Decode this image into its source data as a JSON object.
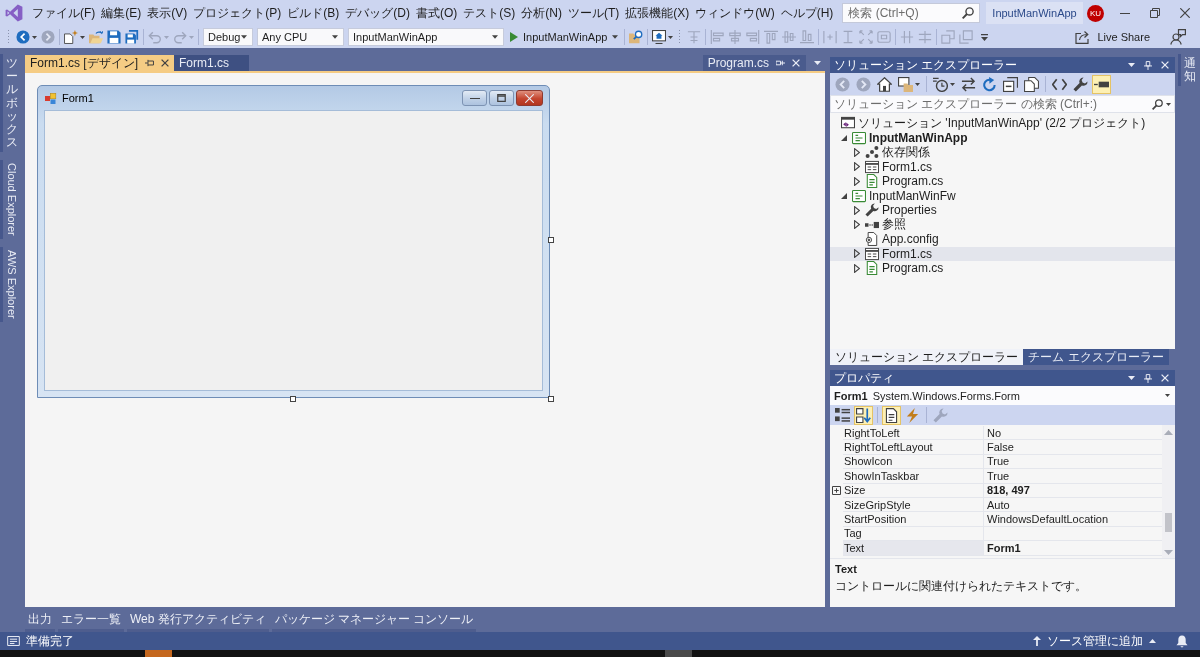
{
  "title_bar": {
    "menu": [
      "ファイル(F)",
      "編集(E)",
      "表示(V)",
      "プロジェクト(P)",
      "ビルド(B)",
      "デバッグ(D)",
      "書式(O)",
      "テスト(S)",
      "分析(N)",
      "ツール(T)",
      "拡張機能(X)",
      "ウィンドウ(W)",
      "ヘルプ(H)"
    ],
    "search": {
      "placeholder": "検索 (Ctrl+Q)"
    },
    "solution_name": "InputManWinApp",
    "user_initials": "KU"
  },
  "toolbar": {
    "items": [
      {
        "kind": "grip"
      },
      {
        "kind": "back",
        "disabled": false,
        "menu": true
      },
      {
        "kind": "forward",
        "disabled": true,
        "menu": false
      },
      {
        "kind": "separator"
      },
      {
        "kind": "new-item",
        "disabled": false,
        "menu": true
      },
      {
        "kind": "open",
        "disabled": false,
        "menu": false
      },
      {
        "kind": "save",
        "disabled": false,
        "menu": false
      },
      {
        "kind": "save-all",
        "disabled": false,
        "menu": false
      },
      {
        "kind": "separator"
      },
      {
        "kind": "undo",
        "disabled": true,
        "menu": true
      },
      {
        "kind": "redo",
        "disabled": true,
        "menu": true
      },
      {
        "kind": "separator"
      },
      {
        "kind": "dropdown",
        "value": "Debug"
      },
      {
        "kind": "dropdown",
        "value": "Any CPU"
      },
      {
        "kind": "dropdown",
        "value": "InputManWinApp"
      },
      {
        "kind": "start",
        "label": "InputManWinApp"
      },
      {
        "kind": "separator"
      },
      {
        "kind": "find-folder",
        "disabled": false,
        "menu": false
      },
      {
        "kind": "separator"
      },
      {
        "kind": "screen",
        "disabled": false,
        "menu": true
      },
      {
        "kind": "grip"
      },
      {
        "kind": "align-grid",
        "disabled": true,
        "menu": false
      },
      {
        "kind": "separator"
      },
      {
        "kind": "align-left",
        "disabled": true,
        "menu": false
      },
      {
        "kind": "align-center",
        "disabled": true,
        "menu": false
      },
      {
        "kind": "align-right",
        "disabled": true,
        "menu": false
      },
      {
        "kind": "align-top",
        "disabled": true,
        "menu": false
      },
      {
        "kind": "align-middle",
        "disabled": true,
        "menu": false
      },
      {
        "kind": "align-bottom",
        "disabled": true,
        "menu": false
      },
      {
        "kind": "separator"
      },
      {
        "kind": "space-h",
        "disabled": true,
        "menu": false
      },
      {
        "kind": "same-height",
        "disabled": true,
        "menu": false
      },
      {
        "kind": "same-size",
        "disabled": true,
        "menu": false
      },
      {
        "kind": "size-grid",
        "disabled": true,
        "menu": false
      },
      {
        "kind": "separator"
      },
      {
        "kind": "center-h",
        "disabled": true,
        "menu": false
      },
      {
        "kind": "center-v",
        "disabled": true,
        "menu": false
      },
      {
        "kind": "separator"
      },
      {
        "kind": "bring-front",
        "disabled": true,
        "menu": false
      },
      {
        "kind": "send-back",
        "disabled": true,
        "menu": false
      },
      {
        "kind": "overflow"
      }
    ],
    "live_share": "Live Share"
  },
  "left_tabs": [
    {
      "label": "ツールボックス",
      "kind": "cjk"
    },
    {
      "label": "Cloud Explorer",
      "kind": "latin"
    },
    {
      "label": "AWS Explorer",
      "kind": "latin"
    }
  ],
  "document_tabs": [
    {
      "label": "Form1.cs [デザイン]",
      "selected": true,
      "buttons": true,
      "preview": false
    },
    {
      "label": "Form1.cs",
      "selected": false,
      "buttons": false,
      "preview": false
    },
    {
      "label": "Program.cs",
      "selected": false,
      "buttons": true,
      "preview": true
    }
  ],
  "designer": {
    "form_title": "Form1"
  },
  "bottom_tabs": [
    "出力",
    "エラー一覧",
    "Web 発行アクティビティ",
    "パッケージ マネージャー コンソール"
  ],
  "solution_explorer": {
    "title": "ソリューション エクスプローラー",
    "toolbar": [
      {
        "kind": "back",
        "disabled": true,
        "selected": false
      },
      {
        "kind": "forward",
        "disabled": true,
        "selected": false
      },
      {
        "kind": "home",
        "disabled": false,
        "selected": false
      },
      {
        "kind": "switch-views",
        "disabled": false,
        "selected": false,
        "menu": true
      },
      {
        "kind": "separator"
      },
      {
        "kind": "history",
        "disabled": false,
        "selected": false,
        "menu": true
      },
      {
        "kind": "sync",
        "disabled": false,
        "selected": false
      },
      {
        "kind": "refresh",
        "disabled": false,
        "selected": false
      },
      {
        "kind": "collapse-all",
        "disabled": false,
        "selected": false
      },
      {
        "kind": "show-all",
        "disabled": false,
        "selected": false
      },
      {
        "kind": "separator"
      },
      {
        "kind": "view-code",
        "disabled": false,
        "selected": false
      },
      {
        "kind": "wrench",
        "disabled": false,
        "selected": false
      },
      {
        "kind": "preview",
        "disabled": false,
        "selected": true
      }
    ],
    "search": {
      "placeholder": "ソリューション エクスプローラー の検索 (Ctrl+:)"
    },
    "tree": [
      {
        "label": "ソリューション 'InputManWinApp' (2/2 プロジェクト)",
        "kind": "solution",
        "selected": false,
        "children": [
          {
            "label": "InputManWinApp",
            "kind": "csproject",
            "expanded": true,
            "startup": true,
            "selected": false,
            "children": [
              {
                "label": "依存関係",
                "kind": "dependencies",
                "expanded": false,
                "selected": false
              },
              {
                "label": "Form1.cs",
                "kind": "form",
                "expanded": false,
                "selected": false
              },
              {
                "label": "Program.cs",
                "kind": "csfile",
                "expanded": false,
                "selected": false
              }
            ]
          },
          {
            "label": "InputManWinFw",
            "kind": "csproject",
            "expanded": true,
            "startup": false,
            "selected": false,
            "children": [
              {
                "label": "Properties",
                "kind": "properties",
                "expanded": false,
                "selected": false
              },
              {
                "label": "参照",
                "kind": "references",
                "expanded": false,
                "selected": false
              },
              {
                "label": "App.config",
                "kind": "config",
                "selected": false
              },
              {
                "label": "Form1.cs",
                "kind": "form",
                "expanded": false,
                "selected": true
              },
              {
                "label": "Program.cs",
                "kind": "csfile",
                "expanded": false,
                "selected": false
              }
            ]
          }
        ]
      }
    ],
    "tabs": [
      {
        "label": "ソリューション エクスプローラー",
        "selected": true
      },
      {
        "label": "チーム エクスプローラー",
        "selected": false
      }
    ]
  },
  "properties": {
    "title": "プロパティ",
    "object": {
      "name": "Form1",
      "type": "System.Windows.Forms.Form"
    },
    "toolbar": [
      {
        "kind": "categorized",
        "disabled": false,
        "selected": false
      },
      {
        "kind": "alphabetical",
        "disabled": false,
        "selected": true
      },
      {
        "kind": "separator"
      },
      {
        "kind": "properties-view",
        "disabled": false,
        "selected": true
      },
      {
        "kind": "events",
        "disabled": false,
        "selected": false
      },
      {
        "kind": "separator"
      },
      {
        "kind": "pages",
        "disabled": true,
        "selected": false
      }
    ],
    "rows": [
      {
        "name": "RightToLeft",
        "value": "No",
        "modified": false,
        "selected": false,
        "expandable": false
      },
      {
        "name": "RightToLeftLayout",
        "value": "False",
        "modified": false,
        "selected": false,
        "expandable": false
      },
      {
        "name": "ShowIcon",
        "value": "True",
        "modified": false,
        "selected": false,
        "expandable": false
      },
      {
        "name": "ShowInTaskbar",
        "value": "True",
        "modified": false,
        "selected": false,
        "expandable": false
      },
      {
        "name": "Size",
        "value": "818, 497",
        "modified": true,
        "selected": false,
        "expandable": true
      },
      {
        "name": "SizeGripStyle",
        "value": "Auto",
        "modified": false,
        "selected": false,
        "expandable": false
      },
      {
        "name": "StartPosition",
        "value": "WindowsDefaultLocation",
        "modified": false,
        "selected": false,
        "expandable": false
      },
      {
        "name": "Tag",
        "selected": false,
        "expandable": false
      },
      {
        "name": "Text",
        "value": "Form1",
        "modified": true,
        "selected": true,
        "expandable": false
      }
    ],
    "description": {
      "title": "Text",
      "text": "コントロールに関連付けられたテキストです。"
    }
  },
  "right_tabs": [
    {
      "label": "通知",
      "kind": "cjk"
    }
  ],
  "status_bar": {
    "text": "準備完了",
    "source_control": "ソース管理に追加"
  }
}
